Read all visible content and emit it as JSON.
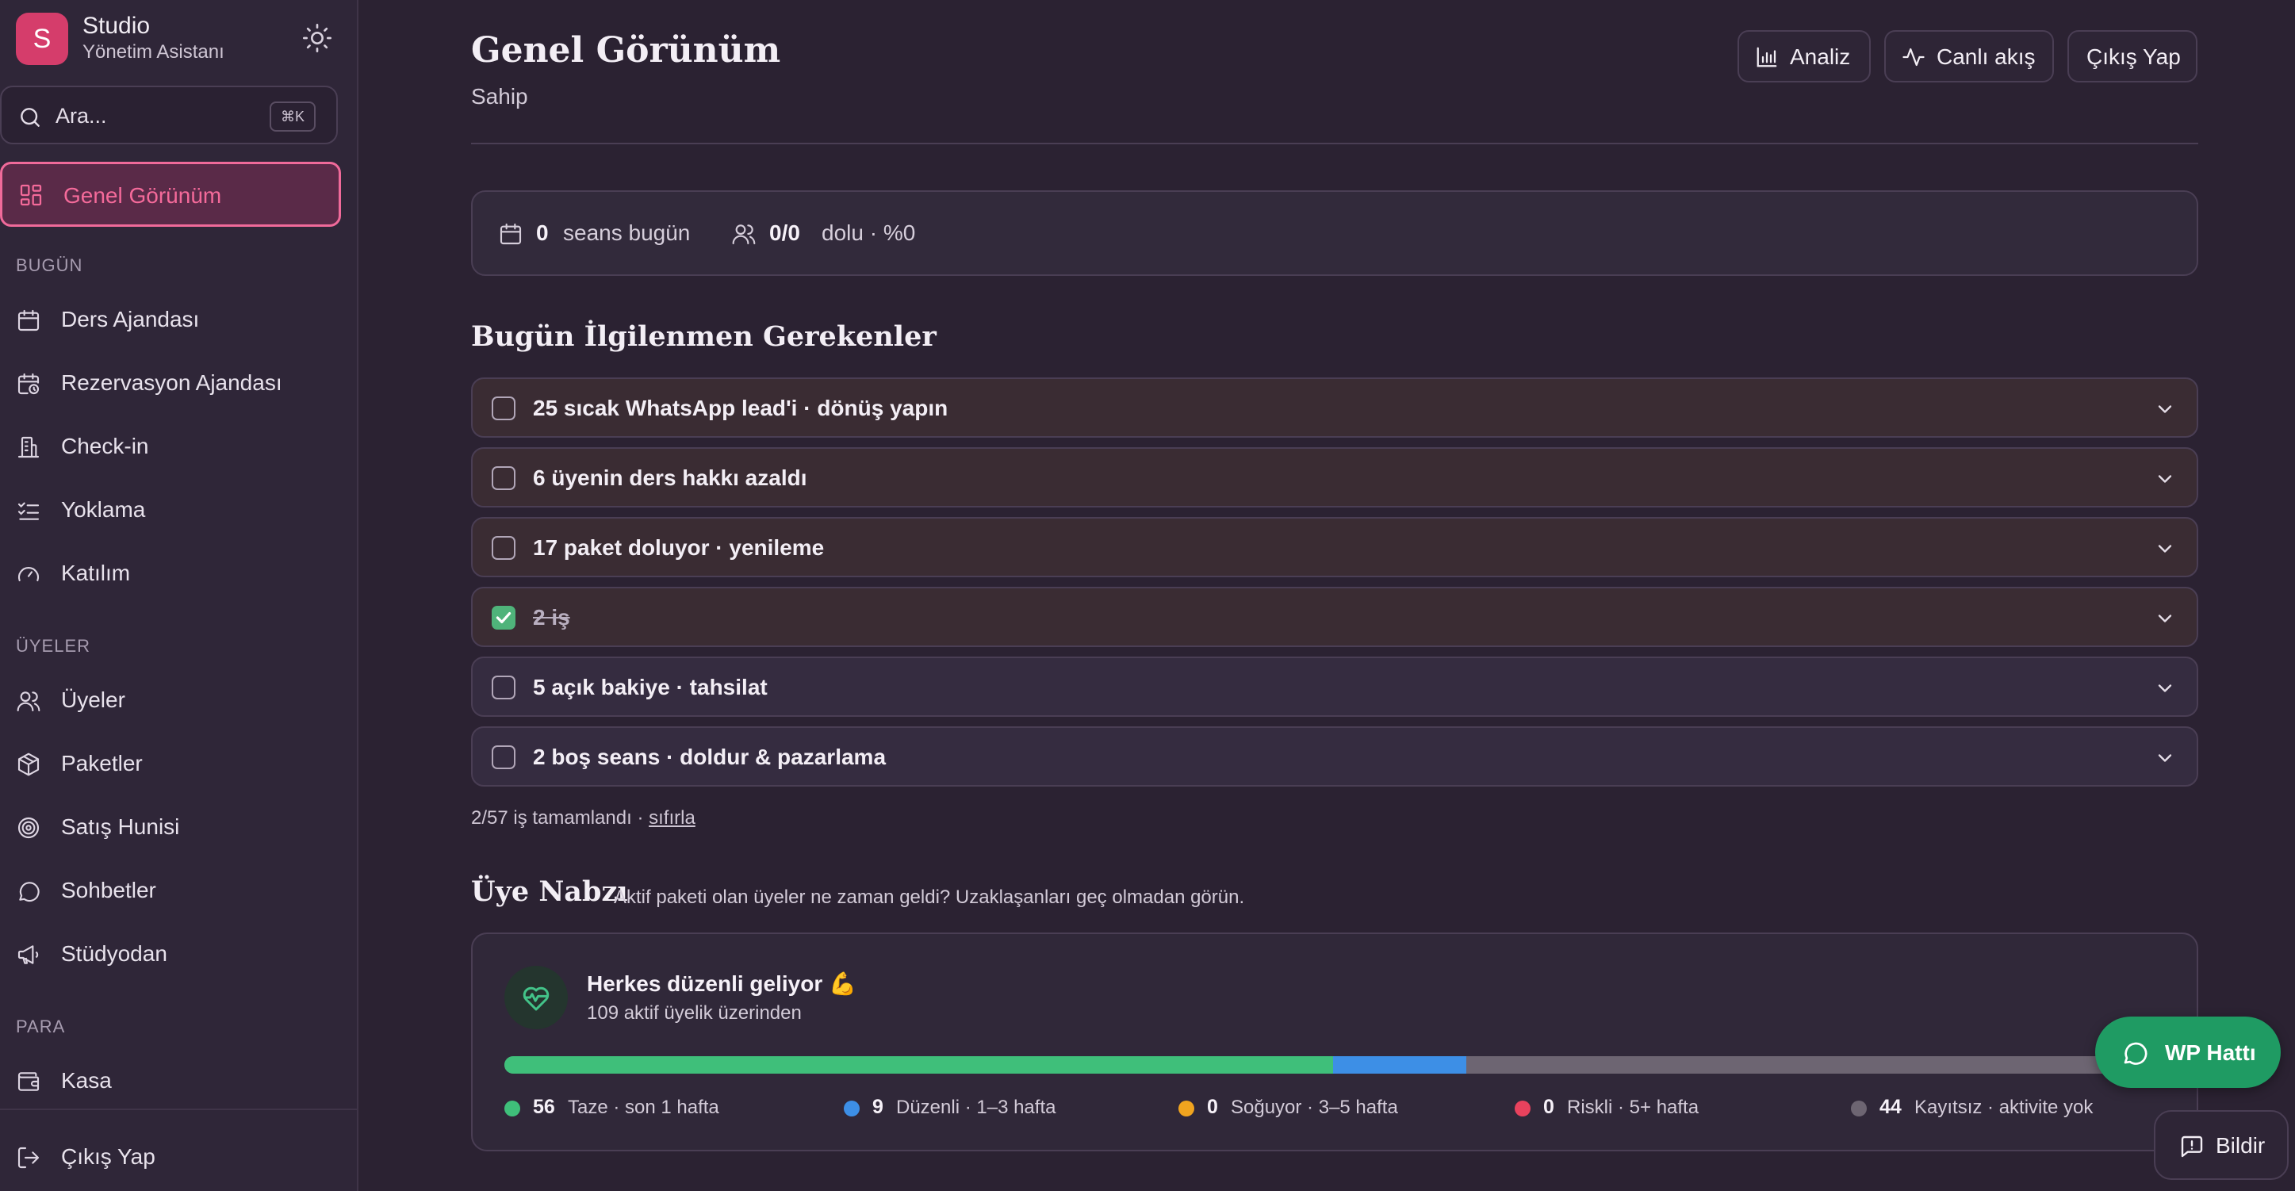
{
  "brand": {
    "initial": "S",
    "title": "Studio",
    "subtitle": "Yönetim Asistanı"
  },
  "search": {
    "placeholder": "Ara...",
    "shortcut": "⌘K"
  },
  "sidebar": {
    "active": {
      "label": "Genel Görünüm",
      "icon": "grid-icon"
    },
    "sections": [
      {
        "title": "BUGÜN",
        "items": [
          {
            "label": "Ders Ajandası",
            "icon": "calendar-icon"
          },
          {
            "label": "Rezervasyon Ajandası",
            "icon": "calendar-clock-icon"
          },
          {
            "label": "Check-in",
            "icon": "building-icon"
          },
          {
            "label": "Yoklama",
            "icon": "list-check-icon"
          },
          {
            "label": "Katılım",
            "icon": "gauge-icon"
          }
        ]
      },
      {
        "title": "ÜYELER",
        "items": [
          {
            "label": "Üyeler",
            "icon": "users-icon"
          },
          {
            "label": "Paketler",
            "icon": "package-icon"
          },
          {
            "label": "Satış Hunisi",
            "icon": "target-icon"
          },
          {
            "label": "Sohbetler",
            "icon": "chat-icon"
          },
          {
            "label": "Stüdyodan",
            "icon": "megaphone-icon"
          }
        ]
      },
      {
        "title": "PARA",
        "items": [
          {
            "label": "Kasa",
            "icon": "wallet-icon"
          }
        ]
      }
    ],
    "logout": "Çıkış Yap"
  },
  "header": {
    "title": "Genel Görünüm",
    "subtitle": "Sahip",
    "buttons": [
      {
        "label": "Analiz",
        "icon": "bar-chart-icon"
      },
      {
        "label": "Canlı akış",
        "icon": "activity-icon"
      },
      {
        "label": "Çıkış Yap",
        "icon": ""
      }
    ]
  },
  "stats": {
    "sessions_value": "0",
    "sessions_label": "seans bugün",
    "occupancy_value": "0/0",
    "occupancy_label": "dolu · %0"
  },
  "tasks": {
    "title": "Bugün İlgilenmen Gerekenler",
    "items": [
      {
        "label": "25 sıcak WhatsApp lead'i · dönüş yapın",
        "done": false
      },
      {
        "label": "6 üyenin ders hakkı azaldı",
        "done": false
      },
      {
        "label": "17 paket doluyor · yenileme",
        "done": false
      },
      {
        "label": "2 iş",
        "done": true
      },
      {
        "label": "5 açık bakiye · tahsilat",
        "done": false
      },
      {
        "label": "2 boş seans · doldur & pazarlama",
        "done": false
      }
    ],
    "progress_text": "2/57 iş tamamlandı · ",
    "reset_label": "sıfırla"
  },
  "pulse": {
    "title": "Üye Nabzı",
    "description": "Aktif paketi olan üyeler ne zaman geldi? Uzaklaşanları geç olmadan görün.",
    "card_title": "Herkes düzenli geliyor 💪",
    "card_subtitle": "109 aktif üyelik üzerinden",
    "total": 109,
    "segments": [
      {
        "count": "56",
        "label": "Taze · son 1 hafta",
        "color": "#3fbf7a",
        "value": 56
      },
      {
        "count": "9",
        "label": "Düzenli · 1–3 hafta",
        "color": "#3d8fe6",
        "value": 9
      },
      {
        "count": "0",
        "label": "Soğuyor · 3–5 hafta",
        "color": "#f0a41f",
        "value": 0
      },
      {
        "count": "0",
        "label": "Riskli · 5+ hafta",
        "color": "#e8425d",
        "value": 0
      },
      {
        "count": "44",
        "label": "Kayıtsız · aktivite yok",
        "color": "#6d6572",
        "value": 44
      }
    ]
  },
  "floating": {
    "whatsapp": "WP Hattı",
    "report": "Bildir"
  },
  "colors": {
    "accent": "#f06a9a",
    "brand": "#d53d6b",
    "success": "#1f9b63"
  }
}
